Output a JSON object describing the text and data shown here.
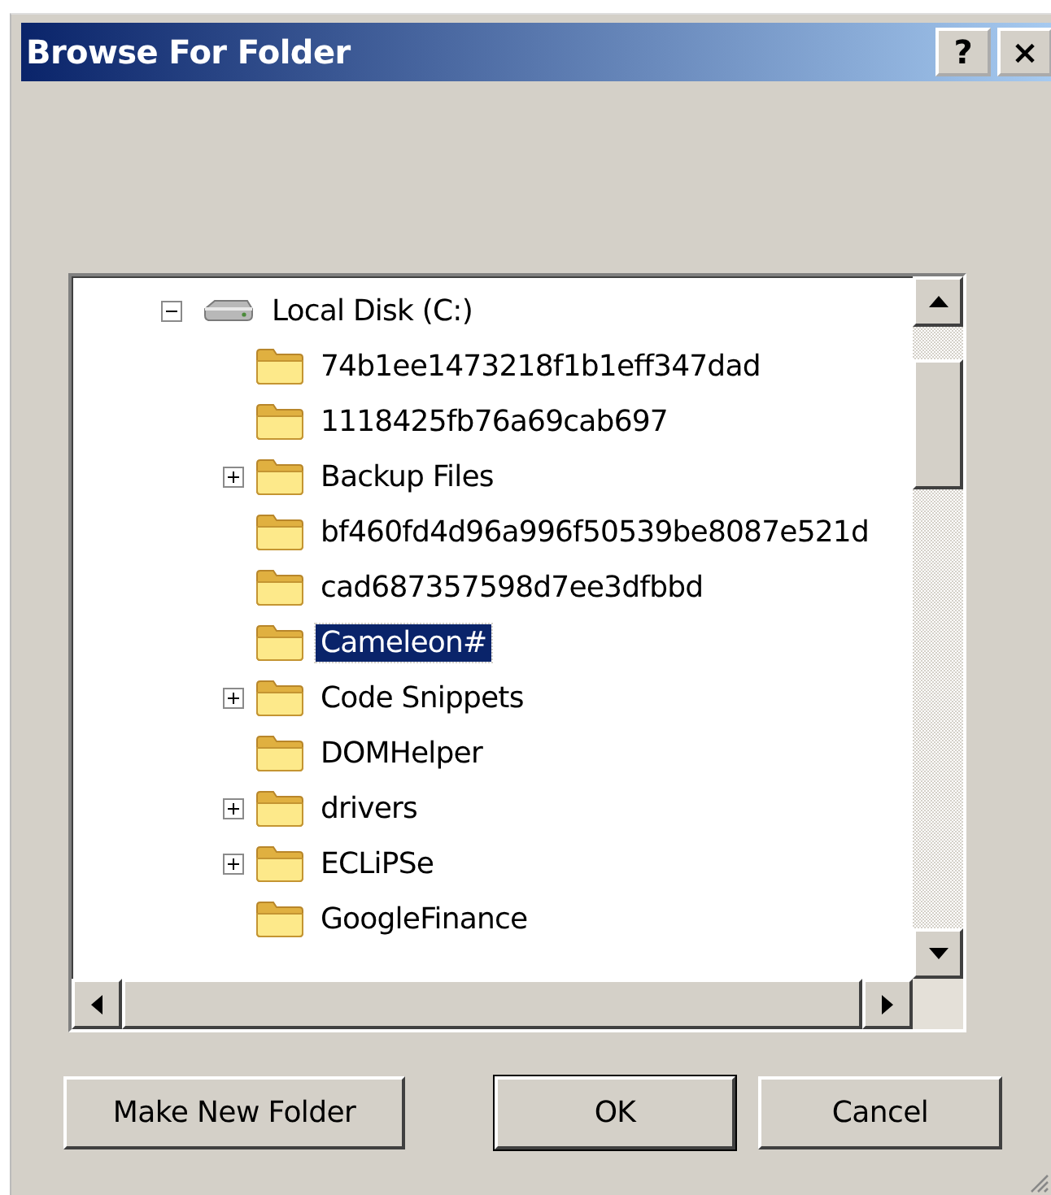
{
  "window": {
    "title": "Browse For Folder",
    "title_buttons": [
      "?",
      "×"
    ]
  },
  "tree": {
    "label": "Local Disk (C:)",
    "kind": "drive",
    "expanded": true,
    "children": [
      {
        "label": "74b1ee1473218f1b1eff347dad",
        "expandable": false,
        "selected": false
      },
      {
        "label": "1118425fb76a69cab697",
        "expandable": false,
        "selected": false
      },
      {
        "label": "Backup Files",
        "expandable": true,
        "selected": false
      },
      {
        "label": "bf460fd4d96a996f50539be8087e521d",
        "expandable": false,
        "selected": false
      },
      {
        "label": "cad687357598d7ee3dfbbd",
        "expandable": false,
        "selected": false
      },
      {
        "label": "Cameleon#",
        "expandable": false,
        "selected": true
      },
      {
        "label": "Code Snippets",
        "expandable": true,
        "selected": false
      },
      {
        "label": "DOMHelper",
        "expandable": false,
        "selected": false
      },
      {
        "label": "drivers",
        "expandable": true,
        "selected": false
      },
      {
        "label": "ECLiPSe",
        "expandable": true,
        "selected": false
      },
      {
        "label": "GoogleFinance",
        "expandable": false,
        "selected": false
      }
    ]
  },
  "buttons": [
    {
      "label": "Make New Folder"
    },
    {
      "label": "OK"
    },
    {
      "label": "Cancel"
    }
  ]
}
